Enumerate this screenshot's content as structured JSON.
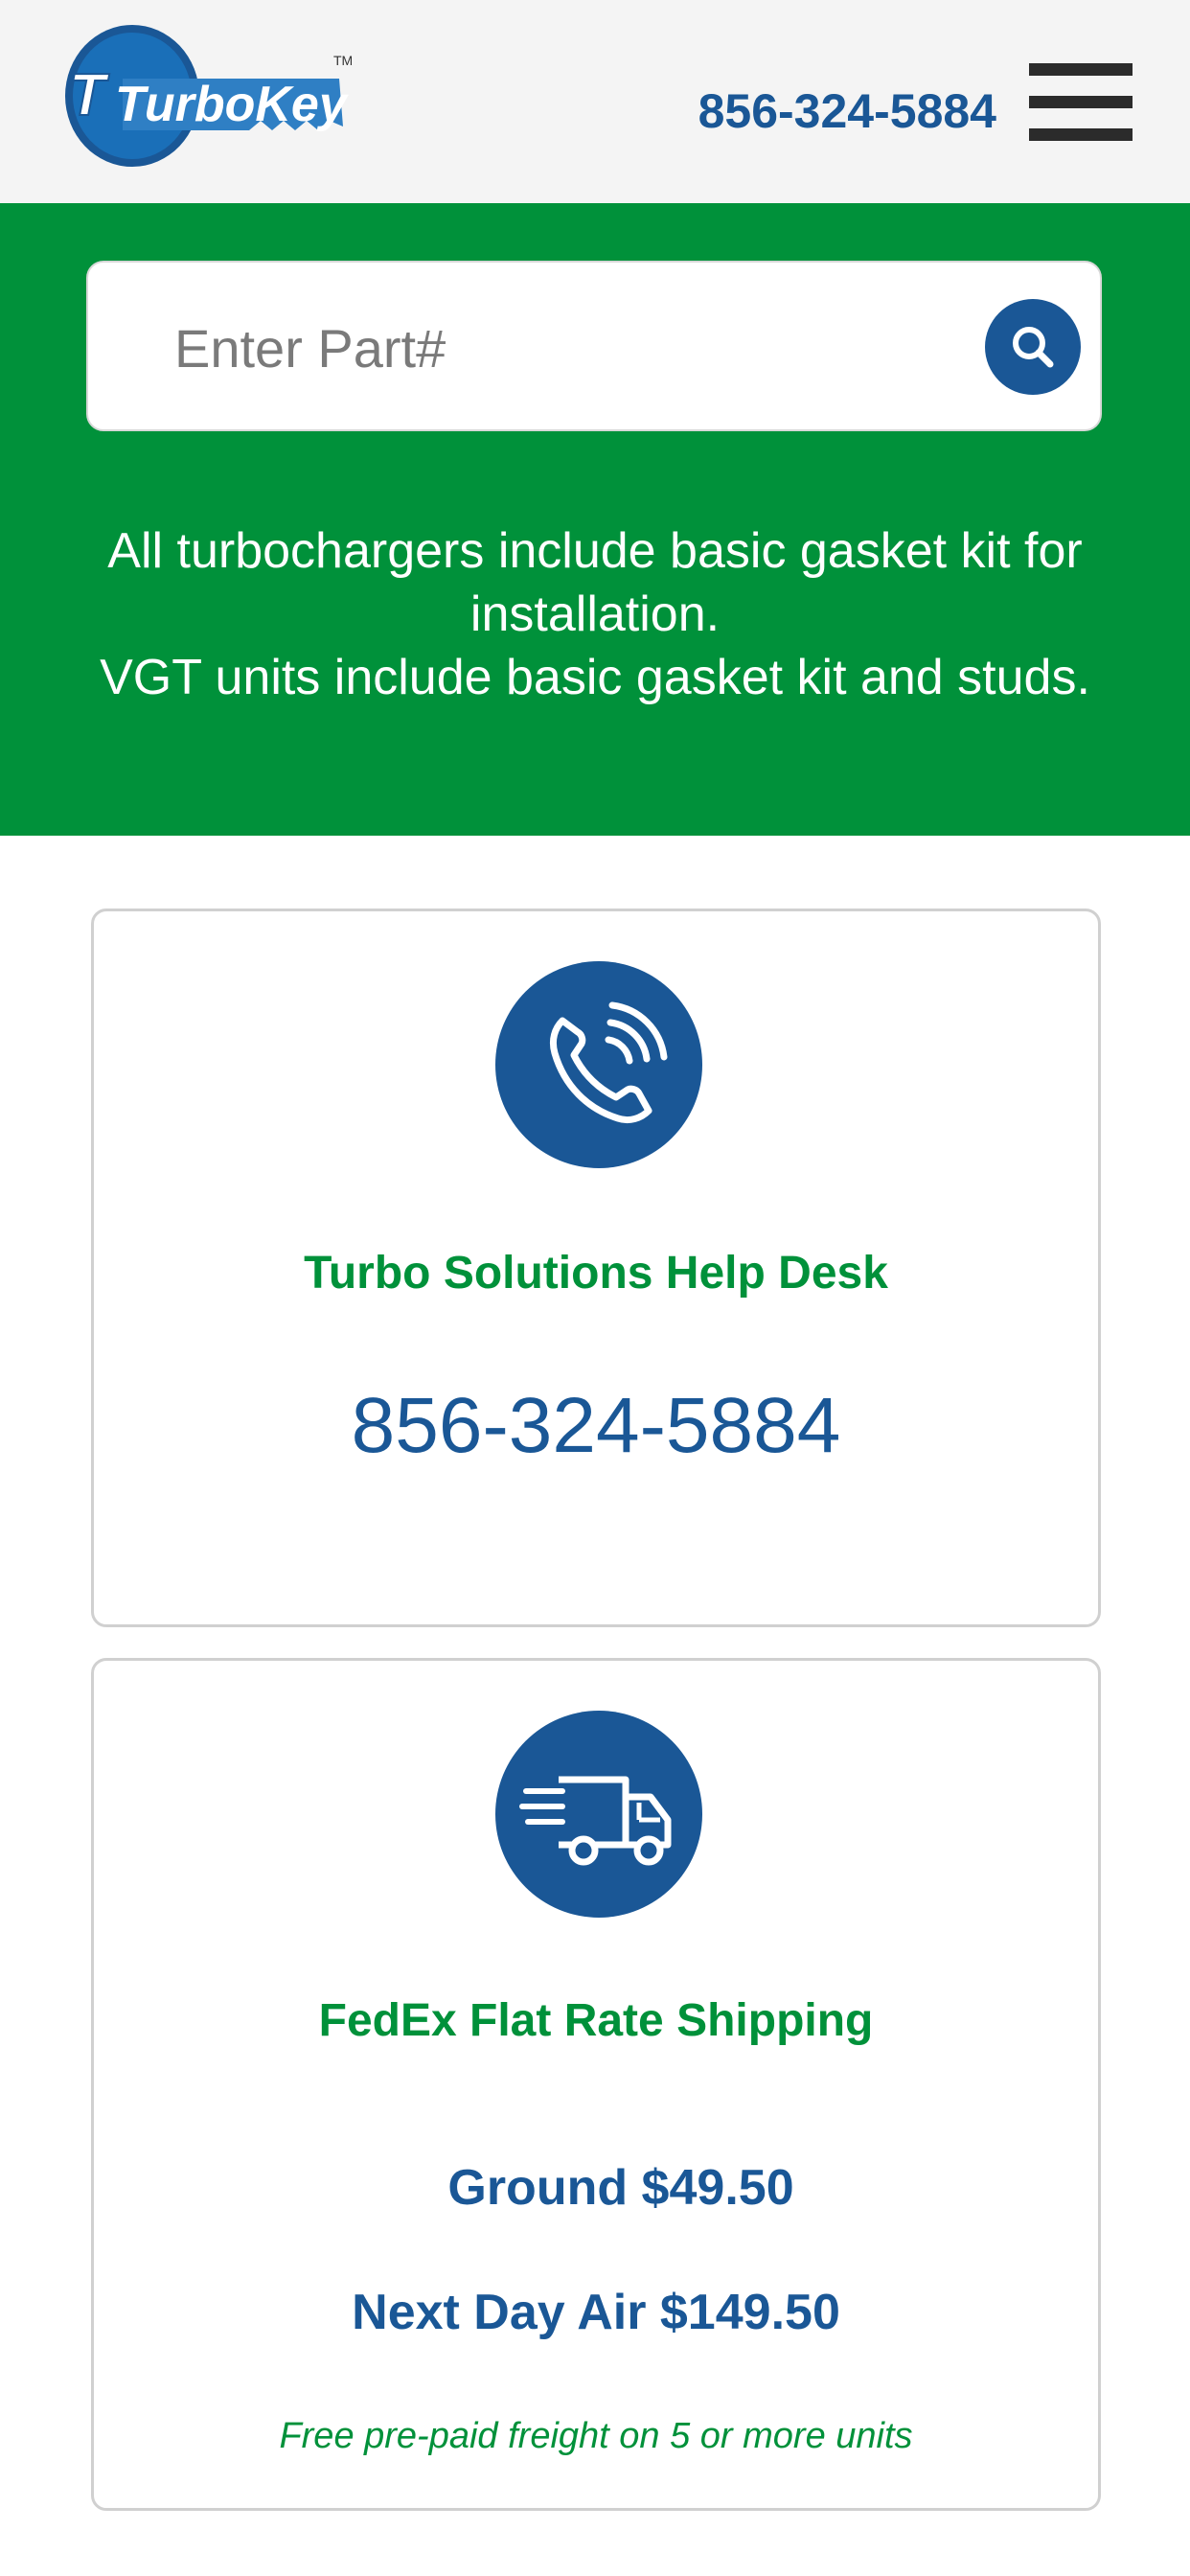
{
  "header": {
    "logo_text": "TurboKey",
    "logo_mark": "TM",
    "phone": "856-324-5884",
    "menu_icon": "hamburger-menu-icon"
  },
  "search": {
    "placeholder": "Enter Part#",
    "value": "",
    "button_icon": "search-icon"
  },
  "notice": {
    "line1": "All turbochargers include basic gasket kit for installation.",
    "line2": "VGT units include basic gasket kit and studs."
  },
  "help_card": {
    "icon": "phone-icon",
    "title": "Turbo Solutions Help Desk",
    "phone": "856-324-5884"
  },
  "shipping_card": {
    "icon": "delivery-truck-icon",
    "title": "FedEx Flat Rate Shipping",
    "ground": "Ground $49.50",
    "next_day": "Next Day Air $149.50",
    "note": "Free pre-paid freight on 5 or more units"
  },
  "colors": {
    "brand_blue": "#1a5796",
    "brand_green": "#00913a",
    "header_bg": "#f4f4f4"
  }
}
